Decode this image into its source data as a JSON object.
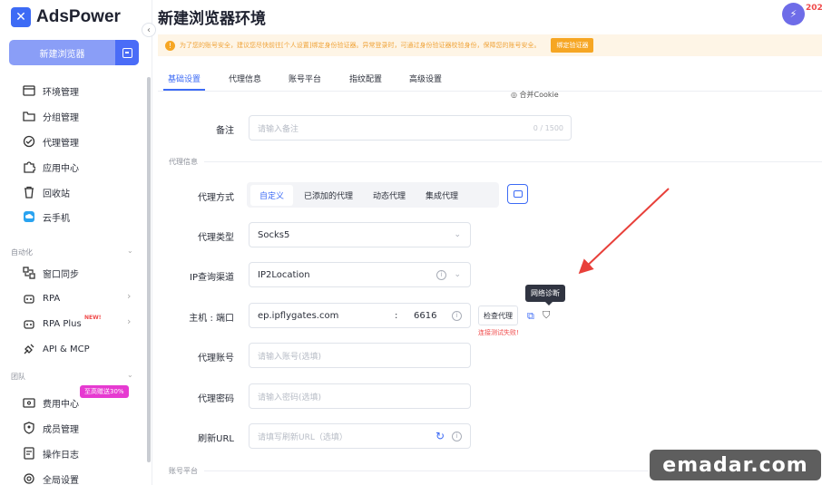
{
  "app": {
    "brand": "AdsPower",
    "page_title": "新建浏览器环境",
    "year_badge": "202"
  },
  "sidebar": {
    "new_button": "新建浏览器",
    "items": [
      {
        "label": "环境管理",
        "icon": "browser-window-icon"
      },
      {
        "label": "分组管理",
        "icon": "folder-icon"
      },
      {
        "label": "代理管理",
        "icon": "globe-icon"
      },
      {
        "label": "应用中心",
        "icon": "puzzle-icon"
      },
      {
        "label": "回收站",
        "icon": "trash-icon"
      },
      {
        "label": "云手机",
        "icon": "cloud-phone-icon"
      }
    ],
    "section_automation": "自动化",
    "automation_items": [
      {
        "label": "窗口同步",
        "icon": "sync-icon"
      },
      {
        "label": "RPA",
        "icon": "robot-icon"
      },
      {
        "label": "RPA Plus",
        "icon": "robot-plus-icon",
        "badge": "NEW!"
      },
      {
        "label": "API & MCP",
        "icon": "api-icon"
      }
    ],
    "section_team": "团队",
    "team_items": [
      {
        "label": "费用中心",
        "icon": "wallet-icon",
        "badge": "至高赠送30%"
      },
      {
        "label": "成员管理",
        "icon": "member-icon"
      },
      {
        "label": "操作日志",
        "icon": "log-icon"
      },
      {
        "label": "全局设置",
        "icon": "settings-icon"
      }
    ]
  },
  "notice": {
    "text": "为了您的账号安全，建议您尽快前往[个人设置]绑定身份验证器。异常登录时，可通过身份验证器校验身份，保障您的账号安全。",
    "button": "绑定验证器"
  },
  "tabs": [
    "基础设置",
    "代理信息",
    "账号平台",
    "指纹配置",
    "高级设置"
  ],
  "active_tab": "基础设置",
  "form": {
    "cookie_option": "合并Cookie",
    "remark_label": "备注",
    "remark_placeholder": "请输入备注",
    "remark_counter": "0 / 1500",
    "proxy_section": "代理信息",
    "proxy_mode_label": "代理方式",
    "proxy_modes": [
      "自定义",
      "已添加的代理",
      "动态代理",
      "集成代理"
    ],
    "proxy_type_label": "代理类型",
    "proxy_type_value": "Socks5",
    "ip_channel_label": "IP查询渠道",
    "ip_channel_value": "IP2Location",
    "host_label": "主机 : 端口",
    "host_value": "ep.ipflygates.com",
    "port_separator": ":",
    "port_value": "6616",
    "check_proxy_button": "检查代理",
    "check_error": "连接测试失败!",
    "diagnose_tooltip": "网络诊断",
    "account_label": "代理账号",
    "account_placeholder": "请输入账号(选填)",
    "password_label": "代理密码",
    "password_placeholder": "请输入密码(选填)",
    "refresh_label": "刷新URL",
    "refresh_placeholder": "请填写刷新URL（选填）",
    "platform_section": "账号平台"
  },
  "watermark": "emadar.com",
  "colors": {
    "accent": "#3d6bf5",
    "warning": "#f6a623",
    "error": "#f04a4a",
    "annotation_arrow": "#e8403a"
  }
}
